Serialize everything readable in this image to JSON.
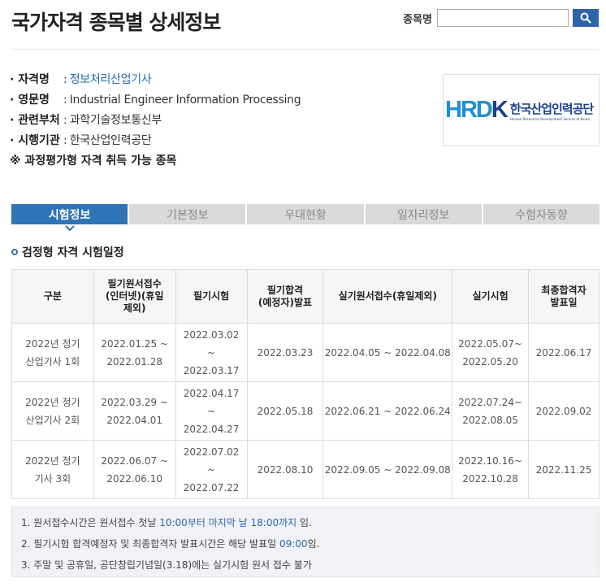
{
  "page_title": "국가자격 종목별 상세정보",
  "search": {
    "label": "종목명",
    "value": "",
    "placeholder": ""
  },
  "info": {
    "rows": [
      {
        "key": "· 자격명",
        "value": "정보처리산업기사"
      },
      {
        "key": "· 영문명",
        "value": "Industrial Engineer Information Processing"
      },
      {
        "key": "· 관련부처",
        "value": "과학기술정보통신부"
      },
      {
        "key": "· 시행기관",
        "value": "한국산업인력공단"
      }
    ],
    "note": "※ 과정평가형 자격 취득 가능 종목"
  },
  "logo": {
    "mark": "HRD",
    "mark_k": "K",
    "name": "한국산업인력공단",
    "english": "Human Resources Development Service of Korea"
  },
  "tabs": [
    "시험정보",
    "기본정보",
    "우대현황",
    "일자리정보",
    "수험자동향"
  ],
  "section_title": "검정형 자격 시험일정",
  "table": {
    "headers": [
      "구분",
      "필기원서접수\n(인터넷)(휴일\n제외)",
      "필기시험",
      "필기합격\n(예정자)발표",
      "실기원서접수(휴일제외)",
      "실기시험",
      "최종합격자\n발표일"
    ],
    "rows": [
      [
        "2022년 정기\n산업기사 1회",
        "2022.01.25 ~\n2022.01.28",
        "2022.03.02\n~\n2022.03.17",
        "2022.03.23",
        "2022.04.05 ~ 2022.04.08",
        "2022.05.07~\n2022.05.20",
        "2022.06.17"
      ],
      [
        "2022년 정기\n산업기사 2회",
        "2022.03.29 ~\n2022.04.01",
        "2022.04.17\n~\n2022.04.27",
        "2022.05.18",
        "2022.06.21 ~ 2022.06.24",
        "2022.07.24~\n2022.08.05",
        "2022.09.02"
      ],
      [
        "2022년 정기\n기사 3회",
        "2022.06.07 ~\n2022.06.10",
        "2022.07.02\n~\n2022.07.22",
        "2022.08.10",
        "2022.09.05 ~ 2022.09.08",
        "2022.10.16~\n2022.10.28",
        "2022.11.25"
      ]
    ]
  },
  "notes": [
    {
      "pre": "1. 원서접수시간은 원서접수 첫날 ",
      "hl": "10:00부터 마지막 날 18:00까지",
      "post": " 임."
    },
    {
      "pre": "2. 필기시험 합격예정자 및 최종합격자 발표시간은 해당 발표일 ",
      "hl": "09:00",
      "post": "임."
    },
    {
      "pre": "3. 주말 및 공휴일, 공단창립기념일(3.18)에는 실기시험 원서 접수 불가",
      "hl": "",
      "post": ""
    }
  ],
  "colors": {
    "accent": "#2f74b5",
    "link": "#2a6ab2",
    "tab_inactive": "#dadada"
  }
}
